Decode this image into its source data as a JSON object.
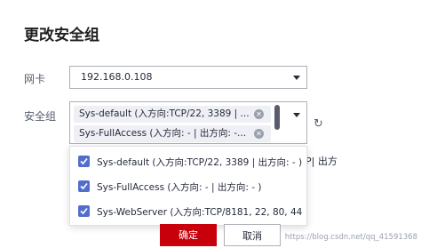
{
  "dialog": {
    "title": "更改安全组",
    "nic_label": "网卡",
    "nic_value": "192.168.0.108",
    "sg_label": "安全组",
    "selected_tags": [
      "Sys-default (入方向:TCP/22, 3389 | ...",
      "Sys-FullAccess (入方向: - | 出方向: -..."
    ],
    "behind_text": "P| 出方",
    "options": [
      {
        "label": "Sys-default (入方向:TCP/22, 3389 | 出方向: - )",
        "checked": true
      },
      {
        "label": "Sys-FullAccess (入方向: - | 出方向: - )",
        "checked": true
      },
      {
        "label": "Sys-WebServer (入方向:TCP/8181, 22, 80, 44...",
        "checked": true
      }
    ],
    "ok_label": "确定",
    "cancel_label": "取消"
  },
  "watermark": "https://blog.csdn.net/qq_41591368",
  "colors": {
    "primary": "#c7000b",
    "checkbox": "#526ecc"
  }
}
